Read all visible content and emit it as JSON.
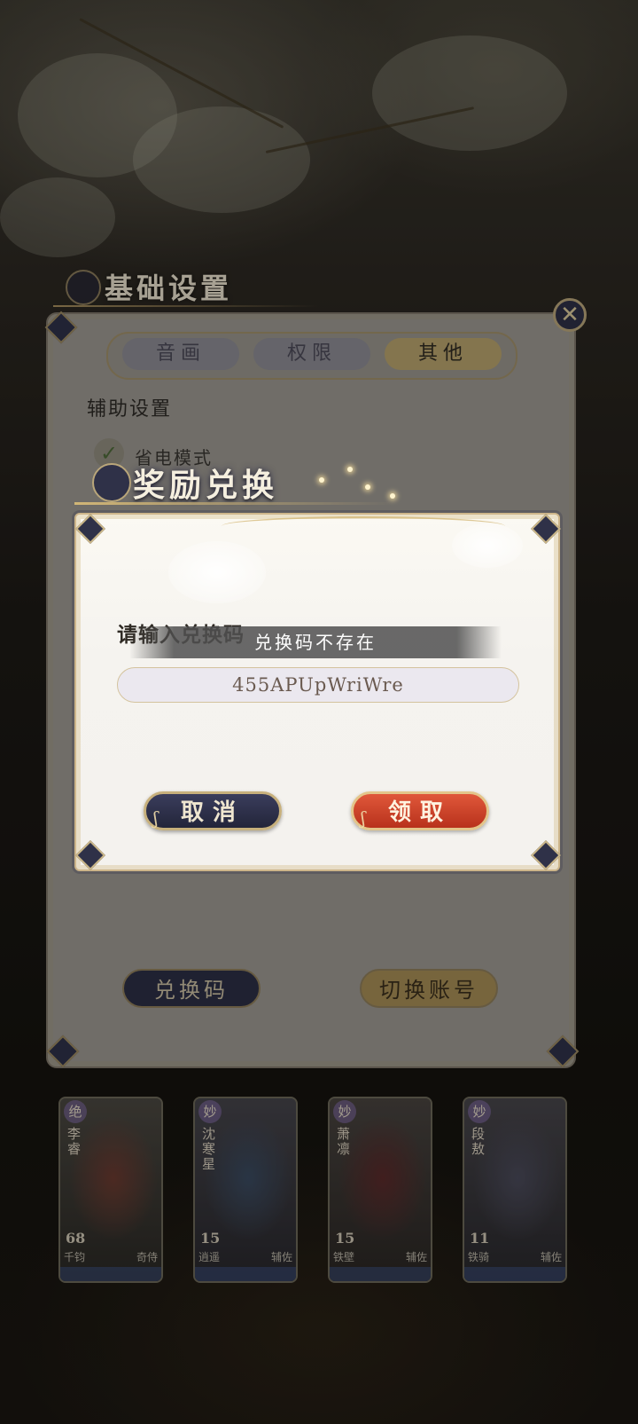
{
  "settings": {
    "title": "基础设置",
    "tabs": [
      {
        "label": "音画",
        "active": false
      },
      {
        "label": "权限",
        "active": false
      },
      {
        "label": "其他",
        "active": true
      }
    ],
    "section_label": "辅助设置",
    "power_saving_label": "省电模式",
    "redeem_code_button": "兑换码",
    "switch_account_button": "切换账号"
  },
  "dialog": {
    "title": "奖励兑换",
    "prompt_label": "请输入兑换码",
    "toast_message": "兑换码不存在",
    "code_value": "455APUpWriWre",
    "cancel_button": "取消",
    "claim_button": "领取"
  },
  "cards": [
    {
      "rarity": "绝",
      "name": "李睿",
      "level": "68",
      "tag_left": "千钧",
      "tag_right": "奇侍"
    },
    {
      "rarity": "妙",
      "name": "沈寒星",
      "level": "15",
      "tag_left": "逍遥",
      "tag_right": "辅佐"
    },
    {
      "rarity": "妙",
      "name": "萧凛",
      "level": "15",
      "tag_left": "铁壁",
      "tag_right": "辅佐"
    },
    {
      "rarity": "妙",
      "name": "段敖",
      "level": "11",
      "tag_left": "铁骑",
      "tag_right": "辅佐"
    }
  ],
  "icons": {
    "close": "close-icon",
    "check": "check-icon",
    "logo": "crest-icon"
  },
  "colors": {
    "claim_accent": "#c9402a",
    "cancel_navy": "#2c2e44",
    "gold_border": "#c7b07c"
  }
}
